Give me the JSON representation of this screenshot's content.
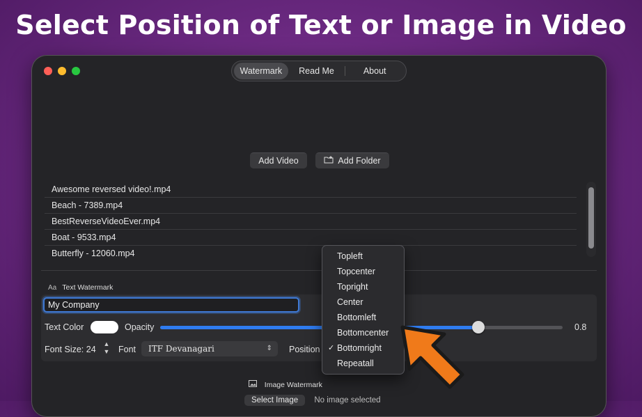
{
  "headline": "Select Position of Text or Image in Video",
  "tabs": [
    "Watermark",
    "Read Me",
    "About"
  ],
  "buttons": {
    "add_video": "Add Video",
    "add_folder": "Add Folder"
  },
  "files": [
    "Awesome reversed video!.mp4",
    "Beach - 7389.mp4",
    "BestReverseVideoEver.mp4",
    "Boat - 9533.mp4",
    "Butterfly - 12060.mp4"
  ],
  "text_watermark": {
    "section_icon": "Aa",
    "title": "Text Watermark",
    "value": "My Company",
    "color_label": "Text Color",
    "color": "#ffffff",
    "opacity_label": "Opacity",
    "opacity": 0.8,
    "opacity_text": "0.8",
    "font_size_label": "Font Size: 24",
    "font_label": "Font",
    "font_value": "ITF Devanagari",
    "position_label": "Position"
  },
  "position_options": [
    "Topleft",
    "Topcenter",
    "Topright",
    "Center",
    "Bottomleft",
    "Bottomcenter",
    "Bottomright",
    "Repeatall"
  ],
  "position_selected": "Bottomright",
  "image_watermark": {
    "title": "Image Watermark",
    "select_label": "Select Image",
    "status": "No image selected"
  },
  "colors": {
    "accent": "#2f7cf0",
    "arrow": "#f07a1a",
    "background": "#6c2a82"
  }
}
